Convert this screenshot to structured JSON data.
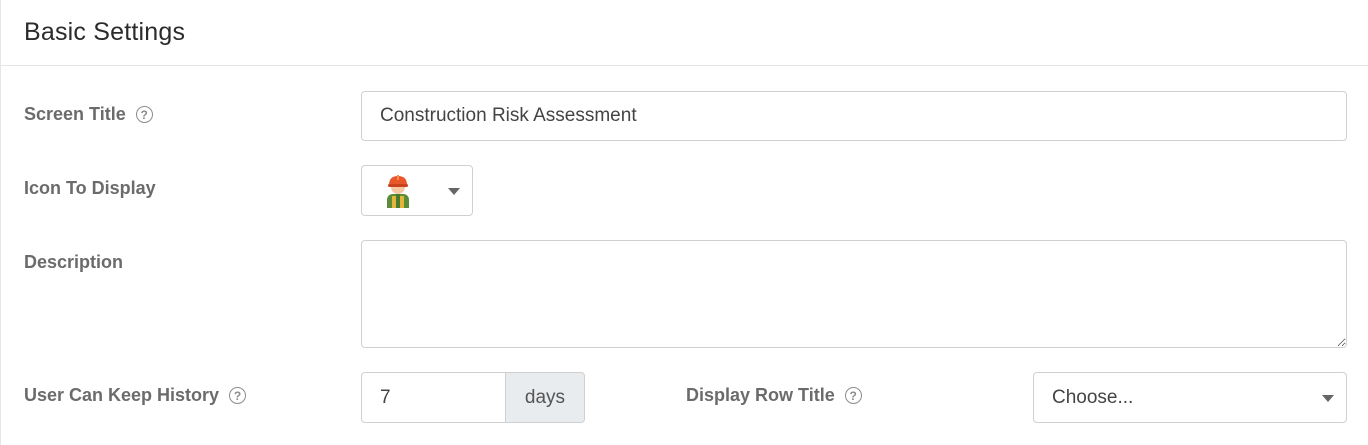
{
  "section": {
    "title": "Basic Settings"
  },
  "fields": {
    "screen_title": {
      "label": "Screen Title",
      "value": "Construction Risk Assessment",
      "help_icon": "question-circle-icon"
    },
    "icon_to_display": {
      "label": "Icon To Display",
      "selected_icon": "construction-worker-icon"
    },
    "description": {
      "label": "Description",
      "value": ""
    },
    "keep_history": {
      "label": "User Can Keep History",
      "value": "7",
      "suffix": "days",
      "help_icon": "question-circle-icon"
    },
    "display_row_title": {
      "label": "Display Row Title",
      "selected": "Choose...",
      "help_icon": "question-circle-icon"
    }
  },
  "colors": {
    "label": "#6b6b6b",
    "border": "#d0d0d0",
    "addon_bg": "#e9ecef",
    "hardhat": "#e8572a"
  }
}
